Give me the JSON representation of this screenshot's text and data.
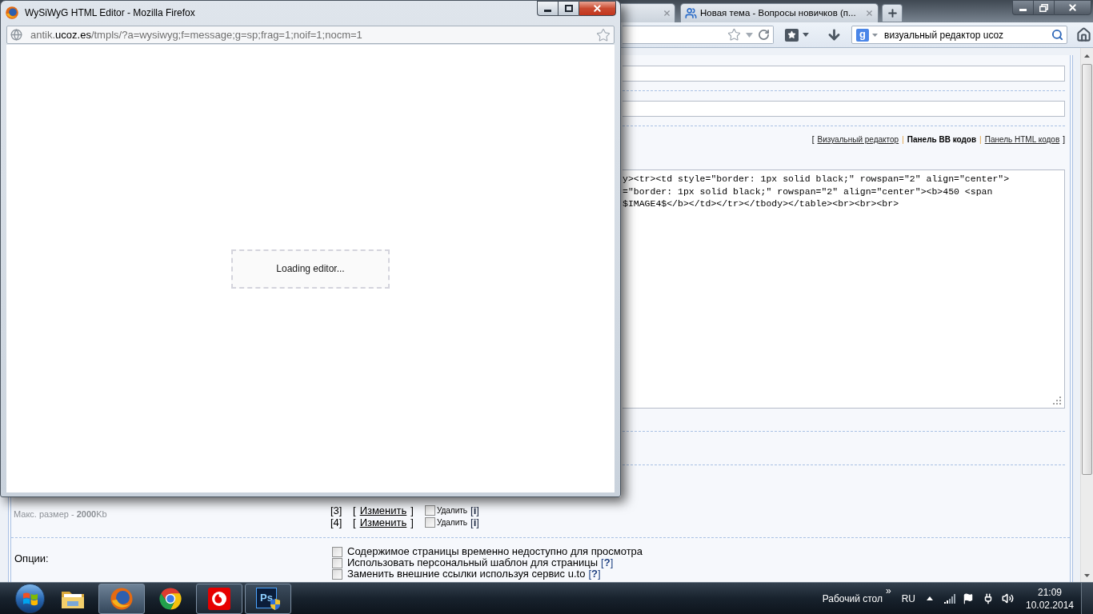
{
  "popup": {
    "active": true,
    "title": "WySiWyG HTML Editor - Mozilla Firefox",
    "url": {
      "subdomain": "antik.",
      "domain": "ucoz.es",
      "path": "/tmpls/?a=wysiwyg;f=message;g=sp;frag=1;noif=1;nocm=1"
    },
    "loading_text": "Loading editor..."
  },
  "browser": {
    "active": false,
    "tabs": [
      {
        "kind": "cut",
        "selected": false
      },
      {
        "kind": "full",
        "label": "Новая тема - Вопросы новичков (п...",
        "selected": false
      }
    ],
    "search": {
      "engine": "g",
      "value": "визуальный редактор ucoz"
    }
  },
  "page": {
    "editor_modes": {
      "open": "[",
      "close": "]",
      "items": [
        {
          "label": "Визуальный редактор",
          "selected": false
        },
        {
          "separator": "|",
          "label": "Панель BB кодов",
          "selected": true
        },
        {
          "separator": "|",
          "label": "Панель HTML кодов",
          "selected": false
        }
      ]
    },
    "code_lines": [
      "y><tr><td style=\"border: 1px solid black;\" rowspan=\"2\" align=\"center\">",
      "=\"border: 1px solid black;\" rowspan=\"2\" align=\"center\"><b>450 <span",
      "$IMAGE4$</b></td></tr></tbody></table><br><br><br>"
    ],
    "max_size": "Макс. размер - **2000**Kb",
    "uploads": [
      {
        "index": "[3]",
        "open": "[",
        "link": "Изменить",
        "close": "]",
        "checked": false,
        "delete_label": "Удалить",
        "info": "[**i**]"
      },
      {
        "index": "[4]",
        "open": "[",
        "link": "Изменить",
        "close": "]",
        "checked": false,
        "delete_label": "Удалить",
        "info": "[**i**]"
      }
    ],
    "options_label": "Опции:",
    "options": [
      {
        "label": "Содержимое страницы временно недоступно для просмотра",
        "checked": false
      },
      {
        "label": "Использовать персональный шаблон для страницы",
        "help": "[**?**]",
        "checked": false
      },
      {
        "label": "Заменить внешние ссылки используя сервис u.to",
        "help": "[**?**]",
        "checked": false
      }
    ]
  },
  "taskbar": {
    "apps": [
      {
        "kind": "folder",
        "running": false,
        "selected": false
      },
      {
        "kind": "globe",
        "running": true,
        "selected": true
      },
      {
        "kind": "wheel",
        "running": false,
        "selected": false
      },
      {
        "kind": "speech",
        "running": true,
        "selected": false
      },
      {
        "kind": "tile",
        "label": "Ps",
        "running": true,
        "selected": false
      }
    ],
    "desktop_label": "Рабочий стол",
    "chevron": "»",
    "language": "RU",
    "time": "21:09",
    "date": "10.02.2014"
  }
}
